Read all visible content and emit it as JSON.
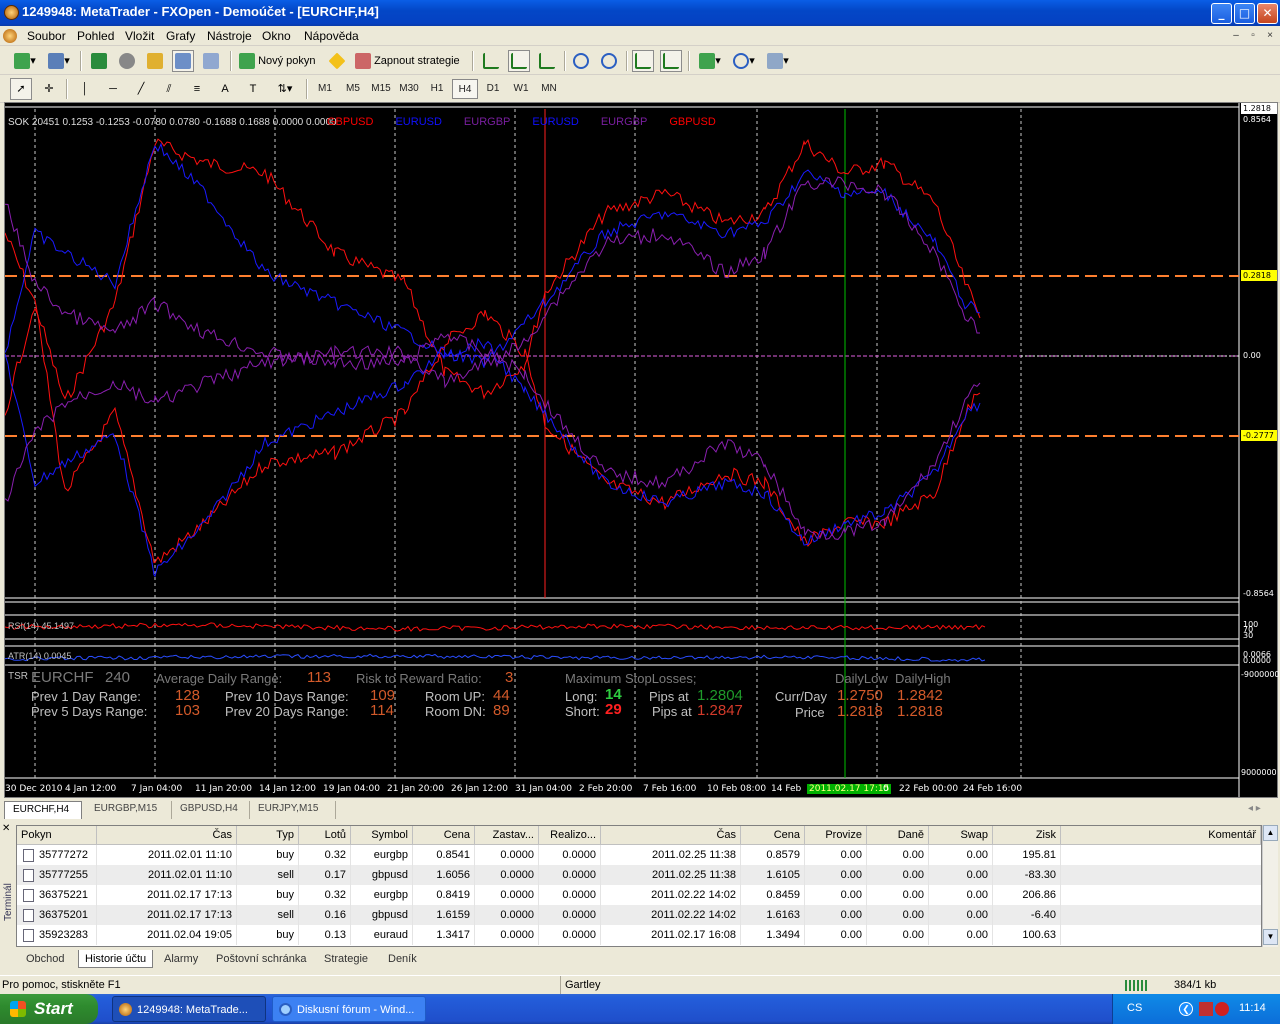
{
  "window": {
    "title": "1249948: MetaTrader - FXOpen - Demoúčet - [EURCHF,H4]",
    "minimize": "_",
    "maximize": "□",
    "close": "✕",
    "mdi": [
      "–",
      "▫",
      "×"
    ]
  },
  "menu": [
    "Soubor",
    "Pohled",
    "Vložit",
    "Grafy",
    "Nástroje",
    "Okno",
    "Nápověda"
  ],
  "toolbar": {
    "new_order": "Nový pokyn",
    "strategy": "Zapnout strategie"
  },
  "drawbar": {
    "text_tool": "A",
    "label_tool": "T"
  },
  "timeframes": [
    "M1",
    "M5",
    "M15",
    "M30",
    "H1",
    "H4",
    "D1",
    "W1",
    "MN"
  ],
  "active_timeframe": "H4",
  "chart": {
    "indicator_header": "SOK 20451 0.1253 -0.1253 -0.0780 0.0780 -0.1688 0.1688 0.0000 0.0000",
    "legend": [
      {
        "name": "GBPUSD",
        "color": "#ff0000"
      },
      {
        "name": "EURUSD",
        "color": "#1010ff"
      },
      {
        "name": "EURGBP",
        "color": "#7a1fa0"
      },
      {
        "name": "EURUSD",
        "color": "#1010ff"
      },
      {
        "name": "EURGBP",
        "color": "#7a1fa0"
      },
      {
        "name": "GBPUSD",
        "color": "#ff0000"
      }
    ],
    "price_labels": {
      "top": "1.2818",
      "max": "0.8564",
      "upper": "0.2818",
      "zero": "0.00",
      "lower": "-0.2777",
      "min": "-0.8564"
    },
    "rsi_label": "RSI(14) 45.1497",
    "rsi_scale": [
      "100",
      "70",
      "30"
    ],
    "atr_label": "ATR(14) 0.0045",
    "atr_scale": [
      "0.0066",
      "0.0000"
    ],
    "tsr_scale": {
      "top": "-9000000",
      "bottom": "9000000"
    },
    "dates": [
      "30 Dec 2010",
      "4 Jan 12:00",
      "7 Jan 04:00",
      "11 Jan 20:00",
      "14 Jan 12:00",
      "19 Jan 04:00",
      "21 Jan 20:00",
      "26 Jan 12:00",
      "31 Jan 04:00",
      "2 Feb 20:00",
      "7 Feb 16:00",
      "10 Feb 08:00",
      "14 Feb",
      "2011.02.17 17:15",
      "0",
      "22 Feb 00:00",
      "24 Feb 16:00"
    ],
    "colors": {
      "red": "#ff1010",
      "blue": "#1a1aff",
      "purple": "#8a1fb0",
      "vline_red": "#ff2020",
      "vline_green": "#00c000"
    }
  },
  "tsr": {
    "name": "TSR",
    "symbol": "EURCHF",
    "period": "240",
    "adr_label": "Average Daily Range:",
    "adr": "113",
    "rr_label": "Risk to Reward Ratio:",
    "rr": "3",
    "prev1_label": "Prev 1 Day Range:",
    "prev1": "128",
    "prev5_label": "Prev 5 Days Range:",
    "prev5": "103",
    "prev10_label": "Prev 10 Days Range:",
    "prev10": "109",
    "prev20_label": "Prev 20 Days Range:",
    "prev20": "114",
    "room_up_label": "Room UP:",
    "room_up": "44",
    "room_dn_label": "Room DN:",
    "room_dn": "89",
    "maxsl_label": "Maximum StopLosses;",
    "long_label": "Long:",
    "long": "14",
    "short_label": "Short:",
    "short": "29",
    "pips_at_label": "Pips at",
    "long_price": "1.2804",
    "short_price": "1.2847",
    "daily_low_label": "DailyLow",
    "daily_high_label": "DailyHigh",
    "currday_label": "Curr/Day",
    "price_label": "Price",
    "currday_low": "1.2750",
    "currday_high": "1.2842",
    "price_low": "1.2818",
    "price_high": "1.2818"
  },
  "chart_tabs": [
    "EURCHF,H4",
    "EURGBP,M15",
    "GBPUSD,H4",
    "EURJPY,M15"
  ],
  "terminal": {
    "side_label": "Terminál",
    "columns": [
      "Pokyn",
      "Čas",
      "Typ",
      "Lotů",
      "Symbol",
      "Cena",
      "Zastav...",
      "Realizo...",
      "Čas",
      "Cena",
      "Provize",
      "Daně",
      "Swap",
      "Zisk",
      "Komentář"
    ],
    "rows": [
      [
        "35777272",
        "2011.02.01 11:10",
        "buy",
        "0.32",
        "eurgbp",
        "0.8541",
        "0.0000",
        "0.0000",
        "2011.02.25 11:38",
        "0.8579",
        "0.00",
        "0.00",
        "0.00",
        "195.81"
      ],
      [
        "35777255",
        "2011.02.01 11:10",
        "sell",
        "0.17",
        "gbpusd",
        "1.6056",
        "0.0000",
        "0.0000",
        "2011.02.25 11:38",
        "1.6105",
        "0.00",
        "0.00",
        "0.00",
        "-83.30"
      ],
      [
        "36375221",
        "2011.02.17 17:13",
        "buy",
        "0.32",
        "eurgbp",
        "0.8419",
        "0.0000",
        "0.0000",
        "2011.02.22 14:02",
        "0.8459",
        "0.00",
        "0.00",
        "0.00",
        "206.86"
      ],
      [
        "36375201",
        "2011.02.17 17:13",
        "sell",
        "0.16",
        "gbpusd",
        "1.6159",
        "0.0000",
        "0.0000",
        "2011.02.22 14:02",
        "1.6163",
        "0.00",
        "0.00",
        "0.00",
        "-6.40"
      ],
      [
        "35923283",
        "2011.02.04 19:05",
        "buy",
        "0.13",
        "euraud",
        "1.3417",
        "0.0000",
        "0.0000",
        "2011.02.17 16:08",
        "1.3494",
        "0.00",
        "0.00",
        "0.00",
        "100.63"
      ]
    ],
    "tabs": [
      "Obchod",
      "Historie účtu",
      "Alarmy",
      "Poštovní schránka",
      "Strategie",
      "Deník"
    ],
    "active_tab": "Historie účtu"
  },
  "status": {
    "help": "Pro pomoc, stiskněte F1",
    "profile": "Gartley",
    "traffic": "384/1 kb"
  },
  "taskbar": {
    "start": "Start",
    "tasks": [
      "1249948: MetaTrade...",
      "Diskusní fórum - Wind..."
    ],
    "lang": "CS",
    "clock": "11:14"
  }
}
